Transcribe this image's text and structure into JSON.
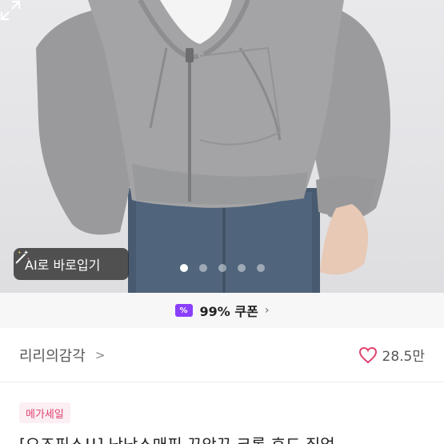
{
  "product_image": {
    "alt": "grey cropped hoodie zip-up",
    "carousel": {
      "total": 5,
      "active": 1
    }
  },
  "ai_button": {
    "label": "AI로 바로입기",
    "icon": "magic-wand-icon"
  },
  "coupon": {
    "badge": "%",
    "text": "99% 쿠폰",
    "chevron": "›"
  },
  "seller": {
    "name": "리리의감각",
    "chevron": ">"
  },
  "likes": {
    "count": "28.5만",
    "icon": "heart-outline-icon",
    "color": "#e1426e"
  },
  "badge": {
    "label": "메가세일"
  },
  "title": "[오즈픽스!!] 낭낭스매핏 끈앞끈 크롭 후드 집업"
}
